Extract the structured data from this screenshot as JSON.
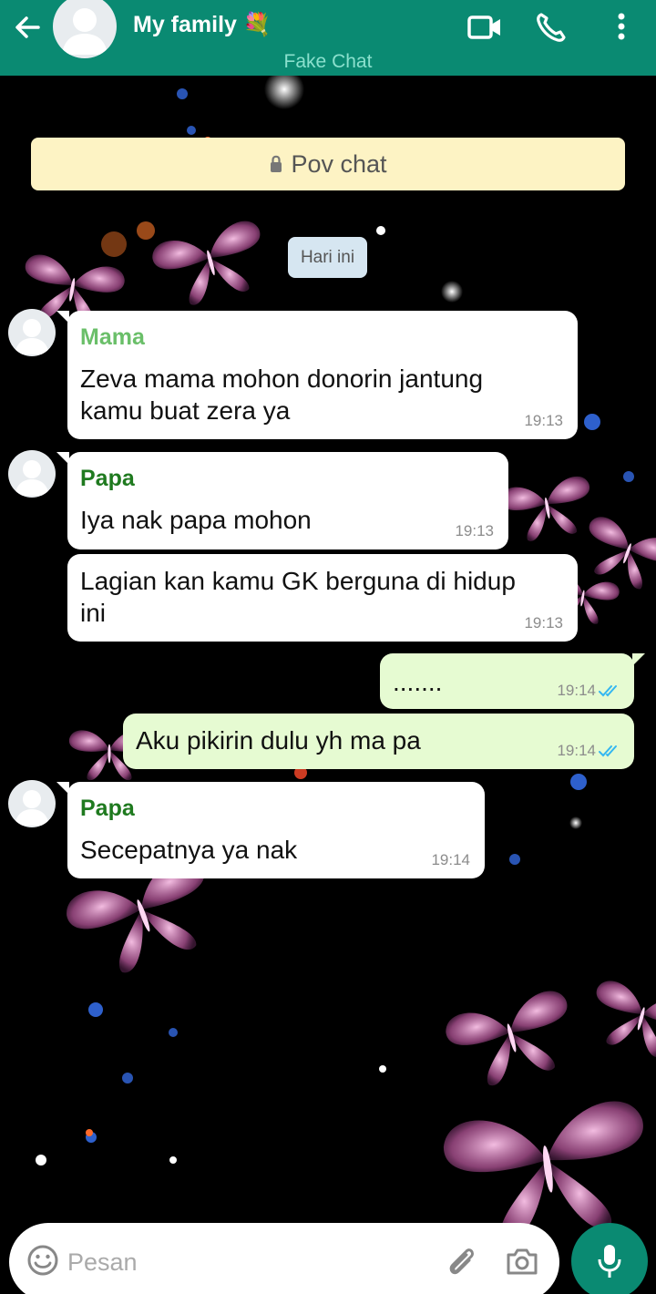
{
  "header": {
    "title": "My family 💐",
    "subtitle": "Fake Chat",
    "colors": {
      "bar": "#0a8a72",
      "subtitle": "#8ae0cd"
    }
  },
  "icons": {
    "back": "arrow-left-icon",
    "video": "video-camera-icon",
    "call": "phone-icon",
    "menu": "more-vertical-icon",
    "lock": "lock-icon",
    "emoji": "emoji-icon",
    "attach": "paperclip-icon",
    "camera": "camera-icon",
    "mic": "microphone-icon",
    "read": "double-check-icon"
  },
  "chat": {
    "banner": "Pov chat",
    "date_chip": "Hari ini",
    "messages": [
      {
        "sender": "Mama",
        "sender_color": "#6abf69",
        "lines": [
          "Zeva mama mohon donorin jantung",
          "kamu buat zera ya"
        ],
        "time": "19:13"
      },
      {
        "sender": "Papa",
        "sender_color": "#1f7a1f",
        "lines": [
          "Iya nak papa mohon"
        ],
        "time": "19:13"
      },
      {
        "lines": [
          "Lagian kan kamu GK berguna di hidup",
          "ini"
        ],
        "time": "19:13"
      },
      {
        "lines": [
          "......."
        ],
        "time": "19:14",
        "status": "read"
      },
      {
        "lines": [
          "Aku pikirin dulu yh ma pa"
        ],
        "time": "19:14",
        "status": "read"
      },
      {
        "sender": "Papa",
        "sender_color": "#1f7a1f",
        "lines": [
          "Secepatnya ya nak"
        ],
        "time": "19:14"
      }
    ]
  },
  "composer": {
    "placeholder": "Pesan",
    "value": ""
  },
  "colors": {
    "incoming_bubble": "#ffffff",
    "outgoing_bubble": "#e6fbd2",
    "tick": "#34b7f1",
    "banner": "#fdf3c4",
    "date_chip": "#d6e6f1"
  }
}
